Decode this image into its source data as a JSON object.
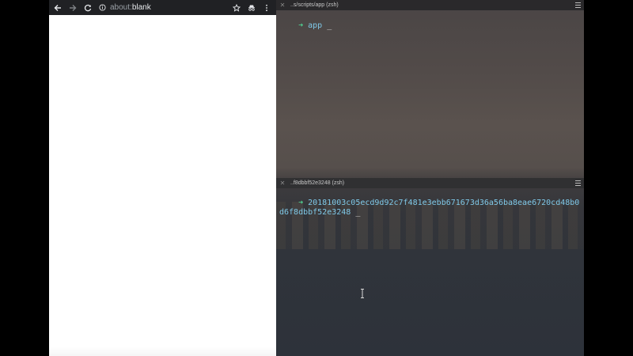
{
  "browser": {
    "url_scheme": "about:",
    "url_path": "blank",
    "icons": {
      "back": "arrow-left-icon",
      "forward": "arrow-right-icon",
      "reload": "reload-icon",
      "info": "info-icon",
      "bookmark": "star-icon",
      "extension": "incognito-icon",
      "menu": "kebab-menu-icon"
    }
  },
  "terminal": {
    "top_pane": {
      "title": "..s/scripts/app (zsh)",
      "prompt": "➜",
      "command": "app",
      "cursor": "_"
    },
    "bottom_pane": {
      "title": "..f8dbbf52e3248 (zsh)",
      "prompt": "➜",
      "command": "20181003c05ecd9d92c7f481e3ebb671673d36a56ba8eae6720cd48b0d6f8dbbf52e3248",
      "cursor": "_"
    },
    "colors": {
      "prompt_arrow": "#4fd191",
      "text": "#7fc9e8"
    }
  }
}
